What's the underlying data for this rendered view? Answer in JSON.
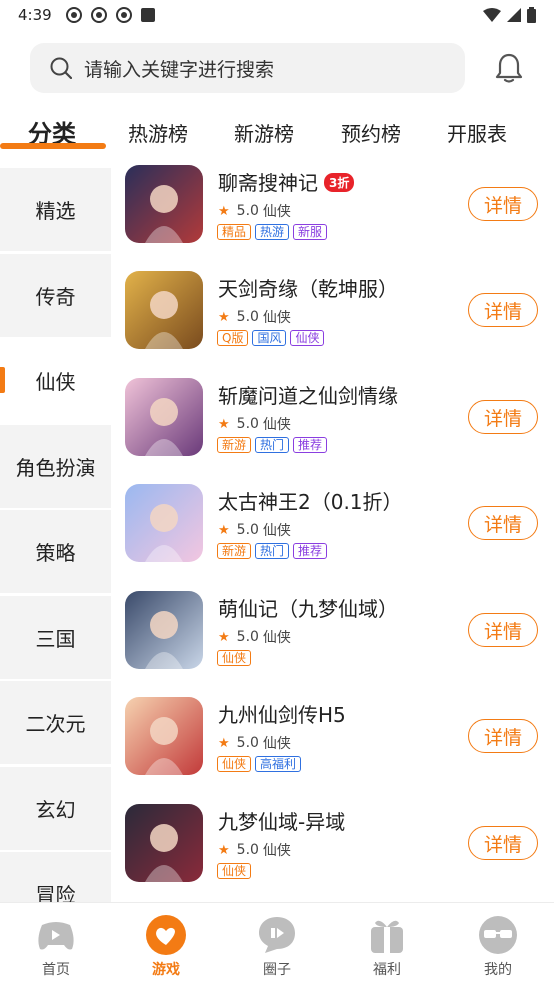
{
  "status_bar": {
    "time": "4:39"
  },
  "header": {
    "search_placeholder": "请输入关键字进行搜索"
  },
  "tabs": [
    "分类",
    "热游榜",
    "新游榜",
    "预约榜",
    "开服表"
  ],
  "categories": [
    "精选",
    "传奇",
    "仙侠",
    "角色扮演",
    "策略",
    "三国",
    "二次元",
    "玄幻",
    "冒险"
  ],
  "active_category": "仙侠",
  "games": [
    {
      "name": "聊斋搜神记",
      "badge": "3折",
      "score": "5.0",
      "genre": "仙侠",
      "tags": [
        {
          "text": "精品",
          "color": "orange"
        },
        {
          "text": "热游",
          "color": "blue"
        },
        {
          "text": "新服",
          "color": "purple"
        }
      ]
    },
    {
      "name": "天剑奇缘（乾坤服）",
      "score": "5.0",
      "genre": "仙侠",
      "tags": [
        {
          "text": "Q版",
          "color": "orange"
        },
        {
          "text": "国风",
          "color": "blue"
        },
        {
          "text": "仙侠",
          "color": "purple"
        }
      ]
    },
    {
      "name": "斩魔问道之仙剑情缘",
      "score": "5.0",
      "genre": "仙侠",
      "tags": [
        {
          "text": "新游",
          "color": "orange"
        },
        {
          "text": "热门",
          "color": "blue"
        },
        {
          "text": "推荐",
          "color": "purple"
        }
      ]
    },
    {
      "name": "太古神王2（0.1折）",
      "score": "5.0",
      "genre": "仙侠",
      "tags": [
        {
          "text": "新游",
          "color": "orange"
        },
        {
          "text": "热门",
          "color": "blue"
        },
        {
          "text": "推荐",
          "color": "purple"
        }
      ]
    },
    {
      "name": "萌仙记（九梦仙域）",
      "score": "5.0",
      "genre": "仙侠",
      "tags": [
        {
          "text": "仙侠",
          "color": "orange"
        }
      ]
    },
    {
      "name": "九州仙剑传H5",
      "score": "5.0",
      "genre": "仙侠",
      "tags": [
        {
          "text": "仙侠",
          "color": "orange"
        },
        {
          "text": "高福利",
          "color": "blue"
        }
      ]
    },
    {
      "name": "九梦仙域-异域",
      "score": "5.0",
      "genre": "仙侠",
      "tags": [
        {
          "text": "仙侠",
          "color": "orange"
        }
      ]
    }
  ],
  "detail_label": "详情",
  "bottom_nav": [
    "首页",
    "游戏",
    "圈子",
    "福利",
    "我的"
  ],
  "active_nav": "游戏",
  "colors": {
    "accent": "#f37b14",
    "tag_blue": "#2f70e0",
    "tag_purple": "#8a3ee0",
    "badge_red": "#e8232a"
  }
}
